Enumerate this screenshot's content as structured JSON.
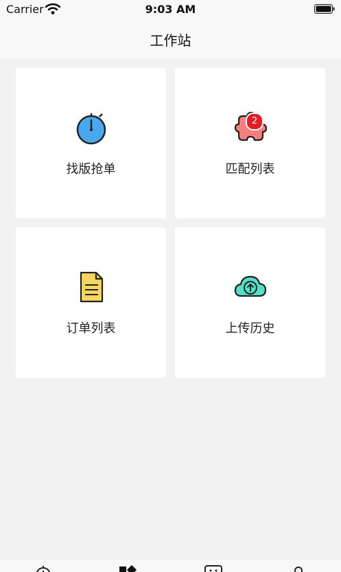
{
  "status_bar": {
    "carrier": "Carrier",
    "time": "9:03 AM"
  },
  "nav": {
    "title": "工作站"
  },
  "cards": [
    {
      "label": "找版抢单",
      "icon": "stopwatch-icon"
    },
    {
      "label": "匹配列表",
      "icon": "puzzle-icon",
      "badge": "2"
    },
    {
      "label": "订单列表",
      "icon": "document-icon"
    },
    {
      "label": "上传历史",
      "icon": "cloud-upload-icon"
    }
  ],
  "colors": {
    "stopwatch_fill": "#4aa8f0",
    "puzzle_fill": "#f77f7f",
    "document_fill": "#f6d65c",
    "cloud_fill": "#53e0c8",
    "badge": "#e51c23"
  },
  "tab_bar": {
    "tabs": [
      {
        "icon": "stopwatch-tab-icon"
      },
      {
        "icon": "grid-tab-icon"
      },
      {
        "icon": "box-tab-icon"
      },
      {
        "icon": "person-tab-icon"
      }
    ]
  }
}
